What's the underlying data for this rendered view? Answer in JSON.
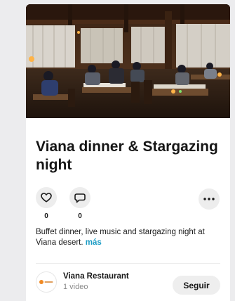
{
  "post": {
    "title": "Viana dinner & Stargazing night",
    "likes": "0",
    "comments": "0",
    "description": "Buffet dinner, live music and stargazing night at Viana desert.",
    "more_label": "más"
  },
  "author": {
    "name": "Viana Restaurant",
    "subtitle": "1 video"
  },
  "follow_label": "Seguir",
  "icons": {
    "like": "heart-outline-icon",
    "comment": "speech-bubble-icon",
    "more": "more-dots-icon"
  },
  "colors": {
    "link": "#1a9bc4",
    "page_bg": "#ececee",
    "button_bg": "#ededed"
  }
}
